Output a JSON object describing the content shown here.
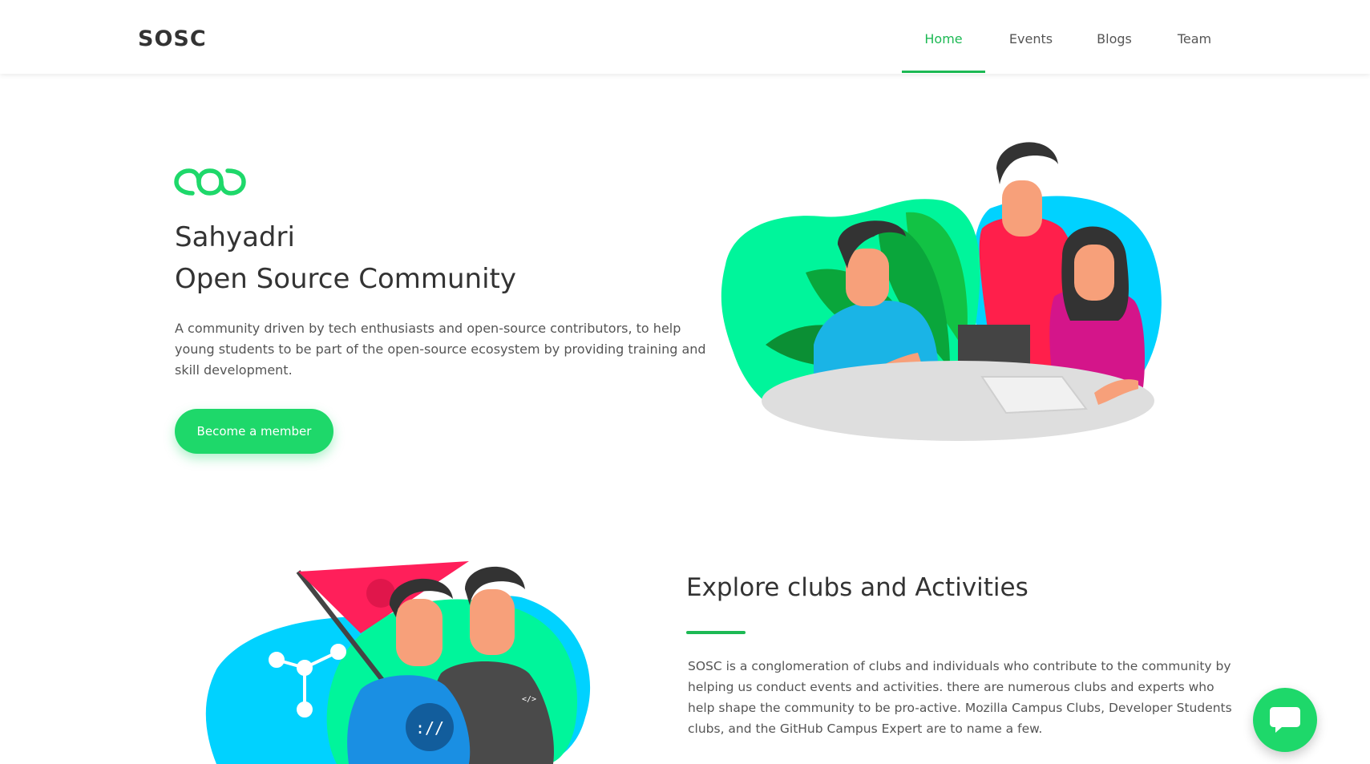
{
  "brand": "SOSC",
  "nav": {
    "items": [
      "Home",
      "Events",
      "Blogs",
      "Team"
    ],
    "active": "Home"
  },
  "hero": {
    "logo_icon": "sosc-infinity-logo-icon",
    "title_line1": "Sahyadri",
    "title_line2": "Open Source Community",
    "description": "A community driven by tech enthusiasts and open-source contributors, to help young students to be part of the open-source ecosystem by providing training and skill development.",
    "cta_label": "Become a member"
  },
  "explore": {
    "title": "Explore clubs and Activities",
    "description": "SOSC is a conglomeration of clubs and individuals who contribute to the community by helping us conduct events and activities. there are numerous clubs and experts who help shape the community to be pro-active. Mozilla Campus Clubs, Developer Students clubs, and the GitHub Campus Expert are to name a few.",
    "shirt_text": "://",
    "shirt_text_2": "</>"
  },
  "chat": {
    "icon": "chat-bubble-icon"
  },
  "colors": {
    "accent": "#1db954",
    "button": "#1ed86a",
    "blob_green": "#00f59b",
    "blob_blue": "#00d2ff",
    "flag_red": "#ff1f5a"
  }
}
